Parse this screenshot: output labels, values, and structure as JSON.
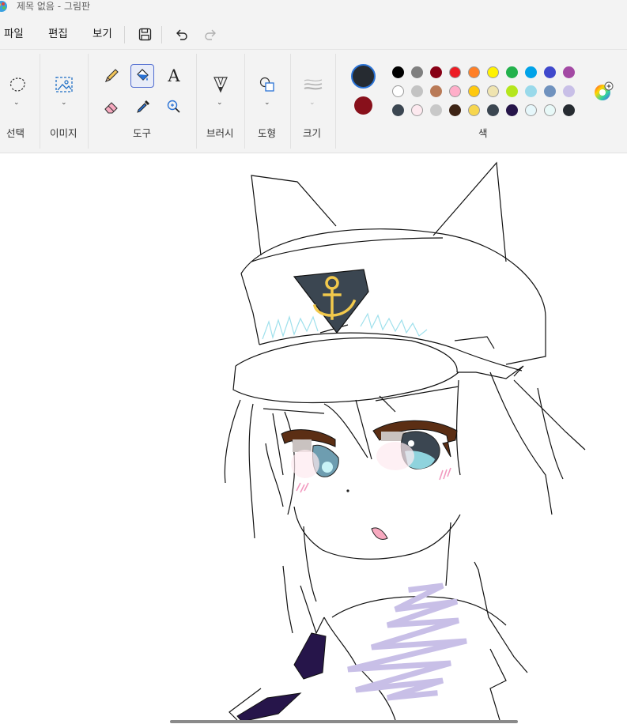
{
  "window": {
    "title": "제목 없음 - 그림판"
  },
  "menu": {
    "file": "파일",
    "edit": "편집",
    "view": "보기"
  },
  "ribbon": {
    "groups": {
      "select": "선택",
      "image": "이미지",
      "tools": "도구",
      "brushes": "브러시",
      "shapes": "도형",
      "size": "크기",
      "colors": "색"
    },
    "text_tool_glyph": "A",
    "primary_color": "#262b31",
    "secondary_color": "#88101b",
    "palette_row1": [
      "#000000",
      "#7f7f7f",
      "#880015",
      "#ed1c24",
      "#ff7f27",
      "#fff200",
      "#22b14c",
      "#00a2e8",
      "#3f48cc",
      "#a349a4"
    ],
    "palette_row2": [
      "#ffffff",
      "#c3c3c3",
      "#b97a57",
      "#ffaec9",
      "#ffc90e",
      "#efe4b0",
      "#b5e61d",
      "#99d9ea",
      "#7092be",
      "#c8bfe7"
    ],
    "palette_row3": [
      "#3b4651",
      "#fde9ef",
      "#c8c8c8",
      "#3d2314",
      "#f7d64e",
      "#3b4651",
      "#26154a",
      "#e6f7fb",
      "#e8f9f8",
      "#262b31"
    ]
  }
}
